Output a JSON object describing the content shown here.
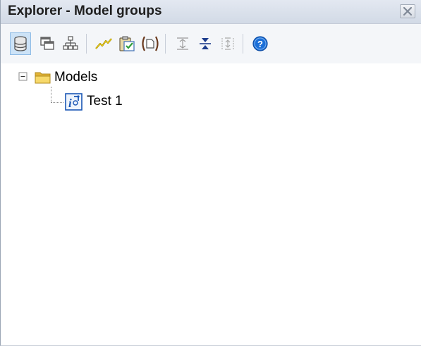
{
  "panel": {
    "title": "Explorer - Model groups"
  },
  "toolbar": {
    "buttons": [
      {
        "name": "database-icon",
        "active": true
      },
      {
        "name": "windows-icon",
        "active": false
      },
      {
        "name": "hierarchy-icon",
        "active": false
      },
      {
        "name": "chart-line-icon",
        "active": false
      },
      {
        "name": "paste-check-icon",
        "active": false
      },
      {
        "name": "bracket-doc-icon",
        "active": false
      },
      {
        "name": "expand-icon",
        "active": false
      },
      {
        "name": "collapse-icon",
        "active": false
      },
      {
        "name": "expand-disabled-icon",
        "active": false
      },
      {
        "name": "help-icon",
        "active": false
      }
    ]
  },
  "tree": {
    "root": {
      "label": "Models",
      "expanded": true,
      "children": [
        {
          "label": "Test 1"
        }
      ]
    }
  },
  "colors": {
    "accent": "#1b6fd8",
    "folder": "#f2c94c",
    "titlebar": "#d9e0ea"
  }
}
